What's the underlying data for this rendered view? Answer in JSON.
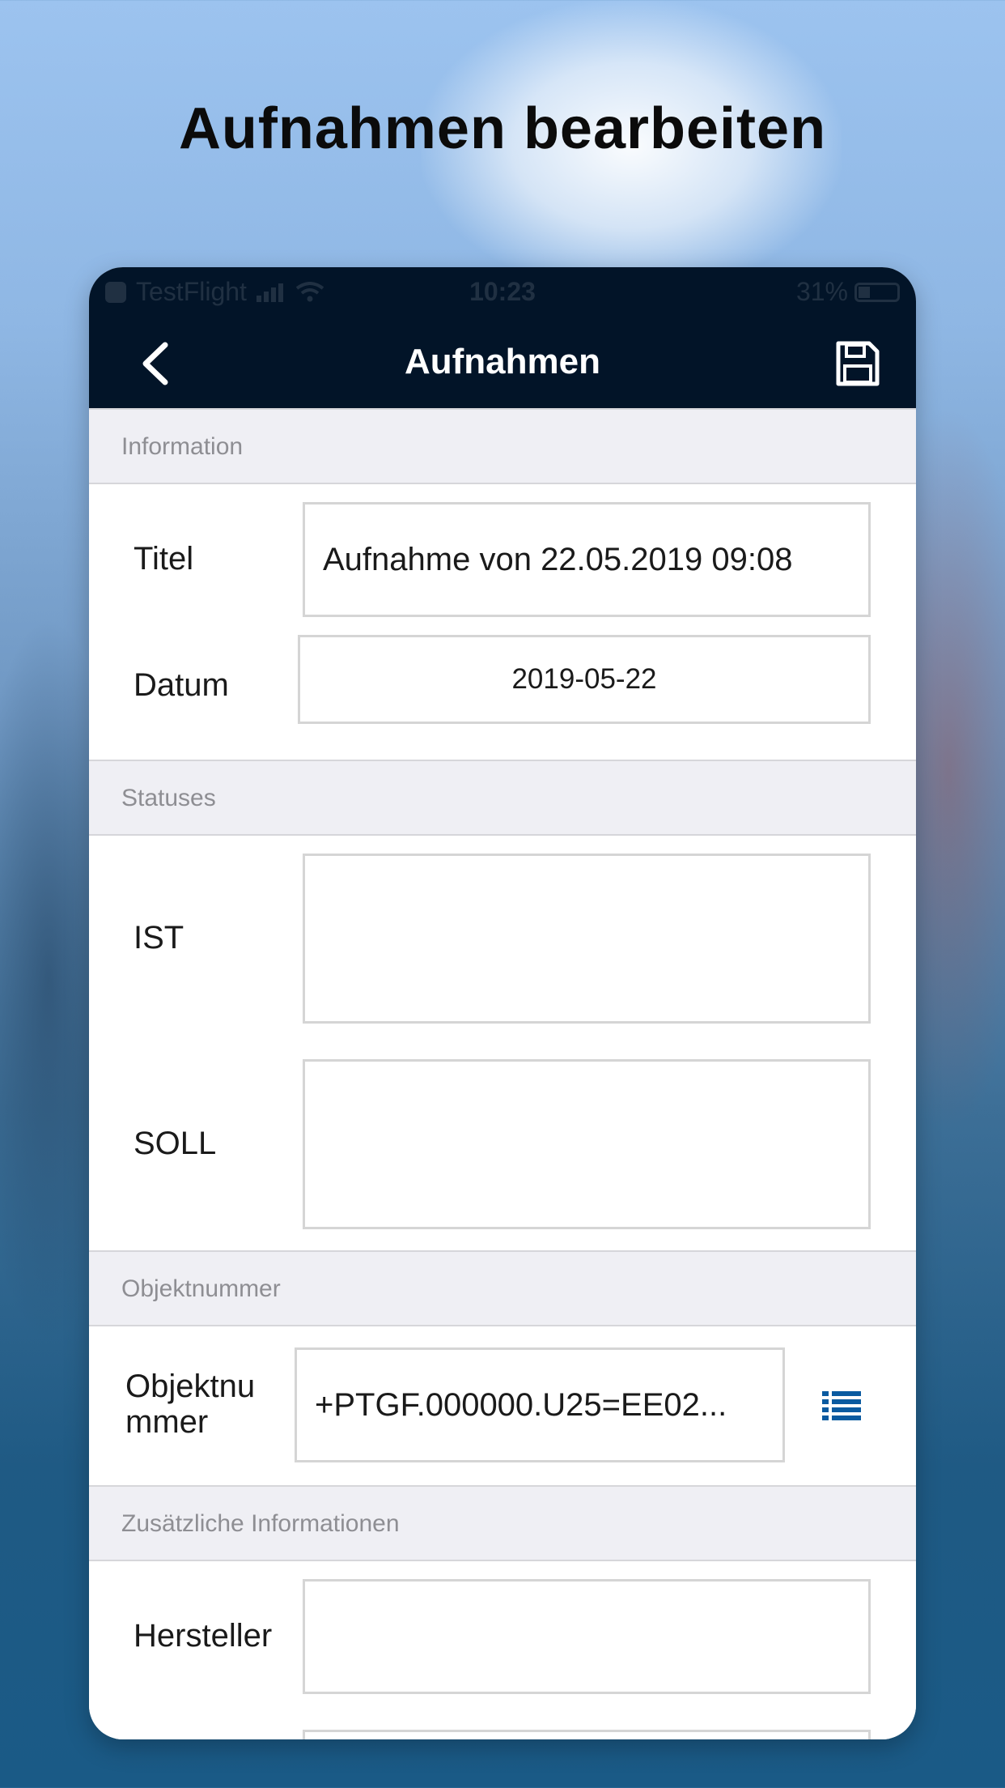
{
  "headline": "Aufnahmen bearbeiten",
  "status_bar": {
    "carrier": "TestFlight",
    "time": "10:23",
    "battery": "31%"
  },
  "nav": {
    "title": "Aufnahmen"
  },
  "sections": {
    "information": {
      "header": "Information",
      "titel_label": "Titel",
      "titel_value": "Aufnahme von 22.05.2019 09:08",
      "datum_label": "Datum",
      "datum_value": "2019-05-22"
    },
    "statuses": {
      "header": "Statuses",
      "ist_label": "IST",
      "ist_value": "",
      "soll_label": "SOLL",
      "soll_value": ""
    },
    "objektnummer": {
      "header": "Objektnummer",
      "label_line1": "Objektnu",
      "label_line2": "mmer",
      "value": "+PTGF.000000.U25=EE02..."
    },
    "zusatz": {
      "header": "Zusätzliche Informationen",
      "hersteller_label": "Hersteller",
      "hersteller_value": ""
    }
  },
  "colors": {
    "navbar": "#021428",
    "accent": "#0a5aa0",
    "section_bg": "#efeff4"
  }
}
